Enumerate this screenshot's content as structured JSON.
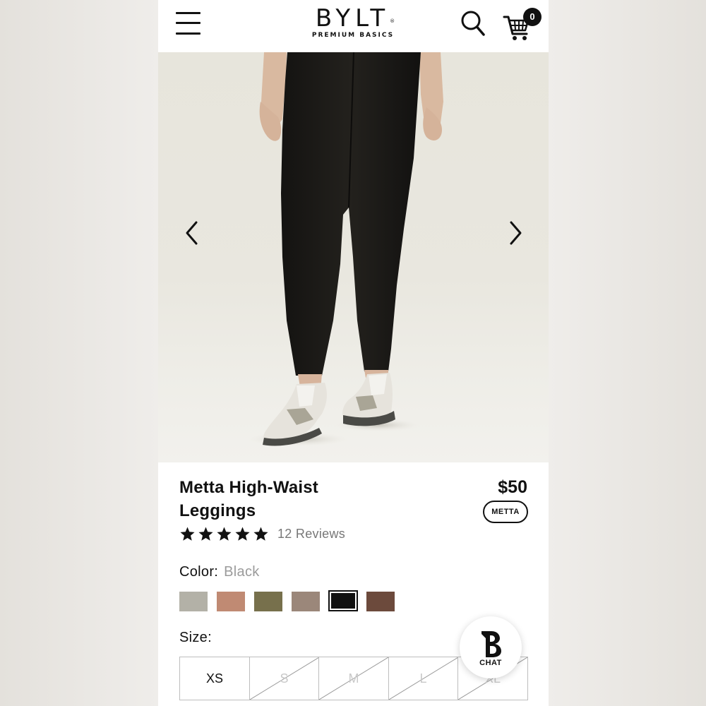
{
  "header": {
    "brand_name": "BYLT",
    "brand_mark": "®",
    "brand_tagline": "PREMIUM BASICS",
    "cart_count": "0"
  },
  "product": {
    "title": "Metta High-Waist Leggings",
    "price": "$50",
    "collection_tag": "METTA",
    "rating": 5,
    "rating_max": 5,
    "reviews_label": "12 Reviews",
    "color_label": "Color:",
    "color_value": "Black",
    "swatches": [
      {
        "name": "grey",
        "color": "#b3b1a7",
        "selected": false
      },
      {
        "name": "terracotta",
        "color": "#c08a73",
        "selected": false
      },
      {
        "name": "olive",
        "color": "#77704c",
        "selected": false
      },
      {
        "name": "taupe",
        "color": "#9b877a",
        "selected": false
      },
      {
        "name": "black",
        "color": "#111111",
        "selected": true
      },
      {
        "name": "brown",
        "color": "#6c4a3c",
        "selected": false
      }
    ],
    "size_label": "Size:",
    "sizes": [
      {
        "label": "XS",
        "available": true
      },
      {
        "label": "S",
        "available": false
      },
      {
        "label": "M",
        "available": false
      },
      {
        "label": "L",
        "available": false
      },
      {
        "label": "XL",
        "available": false
      }
    ]
  },
  "chat": {
    "icon": "bylt-b-icon",
    "label": "CHAT"
  },
  "icons": {
    "menu": "hamburger-menu-icon",
    "search": "search-icon",
    "cart": "shopping-cart-icon",
    "prev": "chevron-left-icon",
    "next": "chevron-right-icon",
    "star": "star-icon"
  }
}
